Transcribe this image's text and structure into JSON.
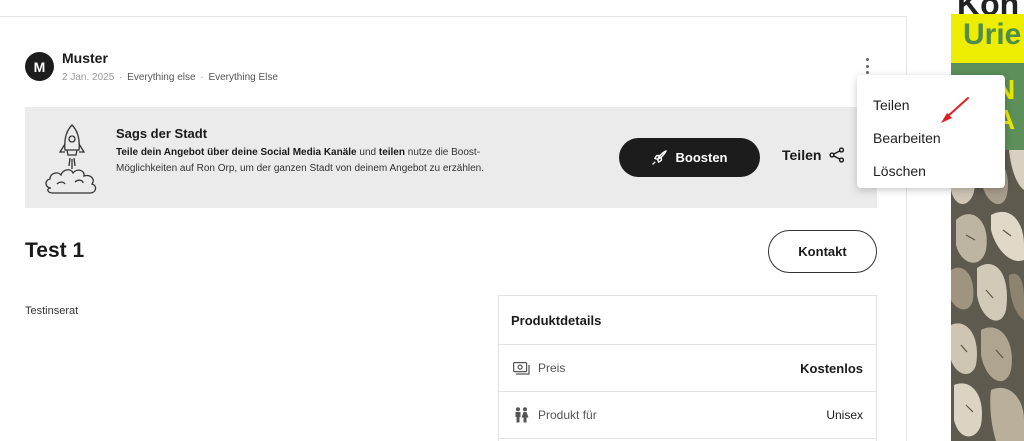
{
  "post": {
    "author_initial": "M",
    "author_name": "Muster",
    "date": "2 Jan. 2025",
    "separator": "·",
    "category_1": "Everything else",
    "category_2": "Everything Else"
  },
  "banner": {
    "title": "Sags der Stadt",
    "text_part1": "Teile dein Angebot über deine Social Media Kanäle",
    "text_part2": " und ",
    "text_part3": "teilen",
    "text_part4": " nutze die Boost-Möglichkeiten auf Ron Orp, um der ganzen Stadt von deinem Angebot zu erzählen.",
    "boost_label": "Boosten",
    "share_label": "Teilen"
  },
  "listing": {
    "title": "Test 1",
    "contact_label": "Kontakt",
    "description": "Testinserat"
  },
  "details": {
    "heading": "Produktdetails",
    "rows": [
      {
        "icon": "money-icon",
        "label": "Preis",
        "value": "Kostenlos"
      },
      {
        "icon": "people-icon",
        "label": "Produkt für",
        "value": "Unisex"
      }
    ]
  },
  "menu": {
    "items": [
      "Teilen",
      "Bearbeiten",
      "Löschen"
    ]
  },
  "ad": {
    "top_text": "Kon",
    "yellow_text": "Urie",
    "green_text": "N\nA"
  },
  "colors": {
    "dark": "#1c1c1c",
    "banner_bg": "#ebebeb",
    "ad_yellow": "#eded00",
    "ad_green": "#5c8f5a",
    "annotation_arrow": "#e02020"
  }
}
